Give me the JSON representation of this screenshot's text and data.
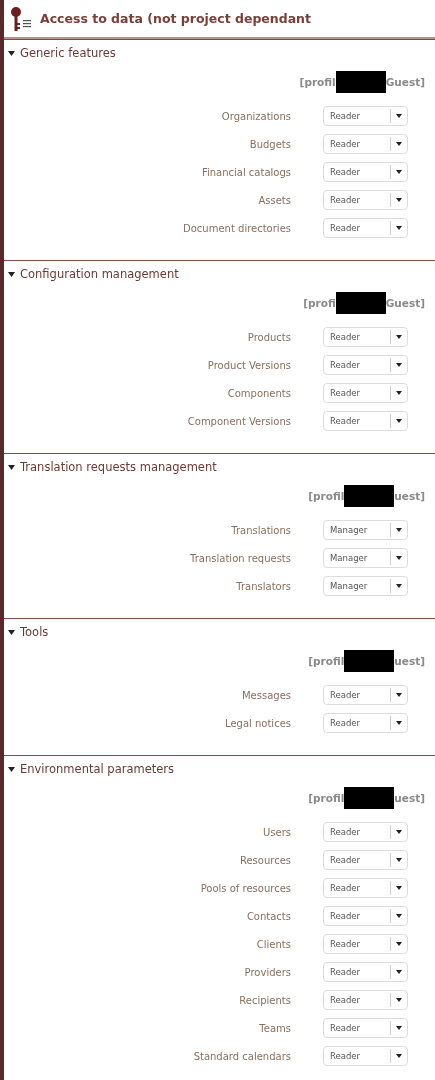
{
  "title": "Access to data (not project dependant",
  "sections": [
    {
      "title": "Generic features",
      "expanded": true,
      "profile": {
        "prefix": "[profil",
        "suffix": "Guest]"
      },
      "rows": [
        {
          "label": "Organizations",
          "value": "Reader"
        },
        {
          "label": "Budgets",
          "value": "Reader"
        },
        {
          "label": "Financial catalogs",
          "value": "Reader"
        },
        {
          "label": "Assets",
          "value": "Reader"
        },
        {
          "label": "Document directories",
          "value": "Reader"
        }
      ]
    },
    {
      "title": "Configuration management",
      "expanded": true,
      "profile": {
        "prefix": "[profi",
        "suffix": "Guest]"
      },
      "rows": [
        {
          "label": "Products",
          "value": "Reader"
        },
        {
          "label": "Product Versions",
          "value": "Reader"
        },
        {
          "label": "Components",
          "value": "Reader"
        },
        {
          "label": "Component Versions",
          "value": "Reader"
        }
      ]
    },
    {
      "title": "Translation requests management",
      "expanded": true,
      "profile": {
        "prefix": "[profil",
        "suffix": "uest]"
      },
      "rows": [
        {
          "label": "Translations",
          "value": "Manager"
        },
        {
          "label": "Translation requests",
          "value": "Manager"
        },
        {
          "label": "Translators",
          "value": "Manager"
        }
      ]
    },
    {
      "title": "Tools",
      "expanded": true,
      "profile": {
        "prefix": "[profil",
        "suffix": "uest]"
      },
      "rows": [
        {
          "label": "Messages",
          "value": "Reader"
        },
        {
          "label": "Legal notices",
          "value": "Reader"
        }
      ]
    },
    {
      "title": "Environmental parameters",
      "expanded": true,
      "profile": {
        "prefix": "[profil",
        "suffix": "uest]"
      },
      "rows": [
        {
          "label": "Users",
          "value": "Reader"
        },
        {
          "label": "Resources",
          "value": "Reader"
        },
        {
          "label": "Pools of resources",
          "value": "Reader"
        },
        {
          "label": "Contacts",
          "value": "Reader"
        },
        {
          "label": "Clients",
          "value": "Reader"
        },
        {
          "label": "Providers",
          "value": "Reader"
        },
        {
          "label": "Recipients",
          "value": "Reader"
        },
        {
          "label": "Teams",
          "value": "Reader"
        },
        {
          "label": "Standard calendars",
          "value": "Reader"
        }
      ]
    }
  ]
}
